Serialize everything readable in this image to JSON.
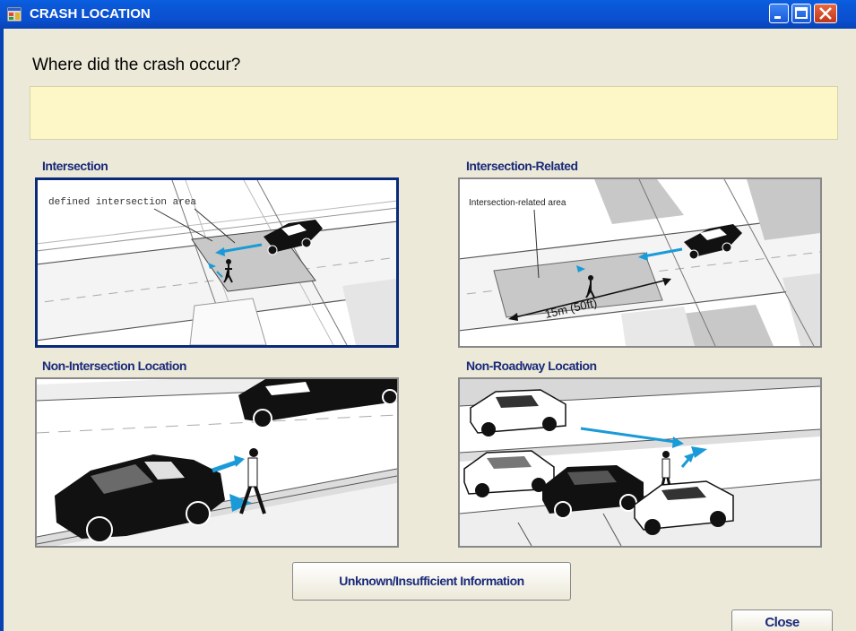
{
  "window": {
    "title": "CRASH LOCATION",
    "controls": [
      "minimize-icon",
      "maximize-icon",
      "close-icon"
    ]
  },
  "question": "Where did the crash occur?",
  "answer_field_value": "",
  "options": [
    {
      "label": "Intersection",
      "selected": true,
      "image_caption": "defined intersection area"
    },
    {
      "label": "Intersection-Related",
      "selected": false,
      "image_caption": "Intersection-related area",
      "measure_label": "15m (50ft)"
    },
    {
      "label": "Non-Intersection Location",
      "selected": false
    },
    {
      "label": "Non-Roadway Location",
      "selected": false
    }
  ],
  "buttons": {
    "unknown": "Unknown/Insufficient Information",
    "close": "Close"
  },
  "colors": {
    "titlebar": "#0a58d8",
    "answer_bg": "#fdf7c8",
    "label_text": "#1a2a7a",
    "arrow": "#1a9ad6"
  }
}
